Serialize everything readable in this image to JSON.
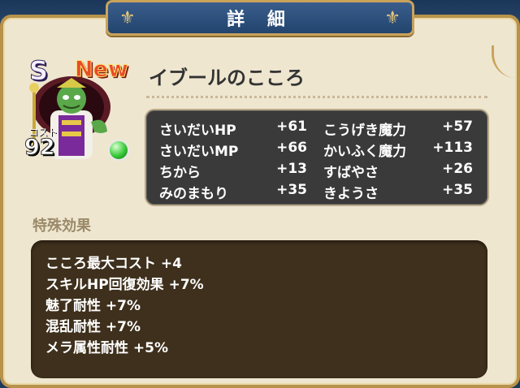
{
  "window": {
    "title": "詳 細"
  },
  "heart": {
    "rank": "S",
    "new_badge": "New",
    "name": "イブールのこころ",
    "cost_label": "コスト",
    "cost_value": "92"
  },
  "stats": [
    {
      "name": "さいだいHP",
      "value": "+61"
    },
    {
      "name": "こうげき魔力",
      "value": "+57"
    },
    {
      "name": "さいだいMP",
      "value": "+66"
    },
    {
      "name": "かいふく魔力",
      "value": "+113"
    },
    {
      "name": "ちから",
      "value": "+13"
    },
    {
      "name": "すばやさ",
      "value": "+26"
    },
    {
      "name": "みのまもり",
      "value": "+35"
    },
    {
      "name": "きようさ",
      "value": "+35"
    }
  ],
  "special": {
    "heading": "特殊効果",
    "effects": [
      "こころ最大コスト +4",
      "スキルHP回復効果 +7%",
      "魅了耐性 +7%",
      "混乱耐性 +7%",
      "メラ属性耐性 +5%"
    ]
  },
  "colors": {
    "panel": "#efe6d0",
    "frame": "#b8924a",
    "stats_bg": "#3a3a3a",
    "special_bg": "#3e301c",
    "orb": "#38c838"
  }
}
